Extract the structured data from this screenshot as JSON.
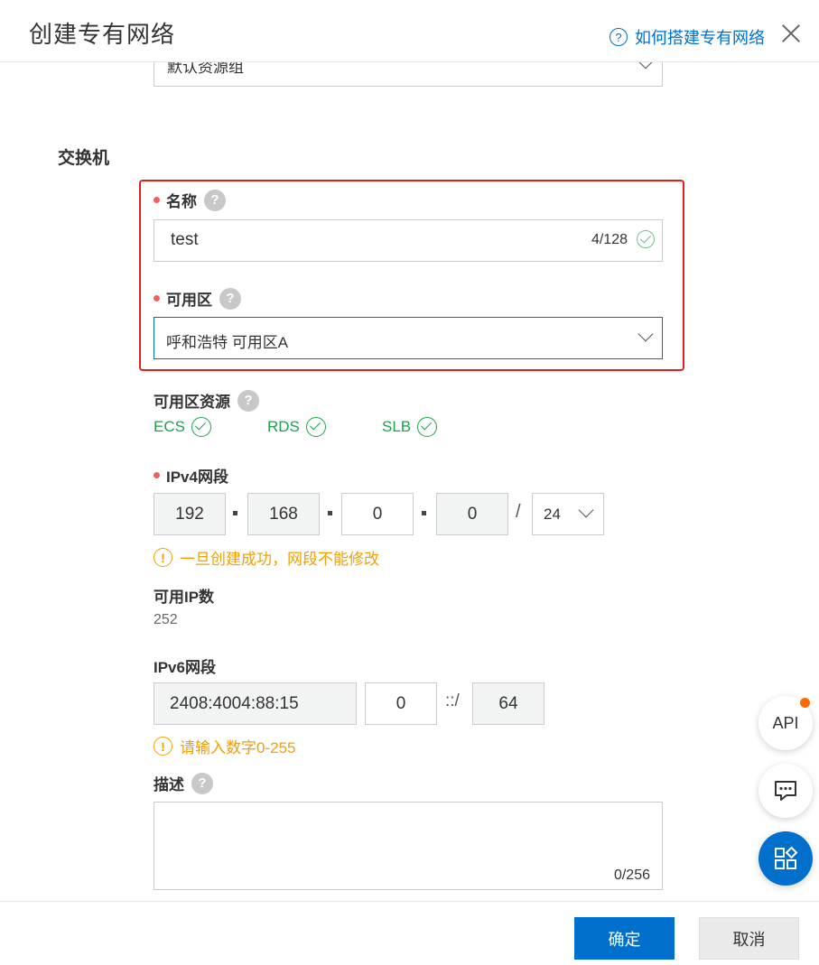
{
  "header": {
    "title": "创建专有网络",
    "help_link": "如何搭建专有网络",
    "help_icon": "?"
  },
  "resource_group": {
    "value": "默认资源组"
  },
  "vswitch": {
    "section_title": "交换机",
    "name": {
      "label": "名称",
      "value": "test",
      "counter": "4/128"
    },
    "zone": {
      "label": "可用区",
      "value": "呼和浩特 可用区A"
    },
    "zone_resources": {
      "label": "可用区资源",
      "items": [
        "ECS",
        "RDS",
        "SLB"
      ]
    },
    "ipv4": {
      "label": "IPv4网段",
      "octets": [
        "192",
        "168",
        "0",
        "0"
      ],
      "slash": "/",
      "mask": "24",
      "warning": "一旦创建成功，网段不能修改"
    },
    "available_ip": {
      "label": "可用IP数",
      "value": "252"
    },
    "ipv6": {
      "label": "IPv6网段",
      "prefix": "2408:4004:88:15",
      "value": "0",
      "separator": "::/",
      "mask": "64",
      "warning": "请输入数字0-255"
    },
    "description": {
      "label": "描述",
      "counter": "0/256"
    }
  },
  "footer": {
    "confirm": "确定",
    "cancel": "取消"
  },
  "floating": {
    "api": "API"
  },
  "colors": {
    "primary": "#0070cc",
    "success": "#1aa34a",
    "warning": "#f0a000",
    "required": "#f06060",
    "highlight": "#e02020"
  }
}
